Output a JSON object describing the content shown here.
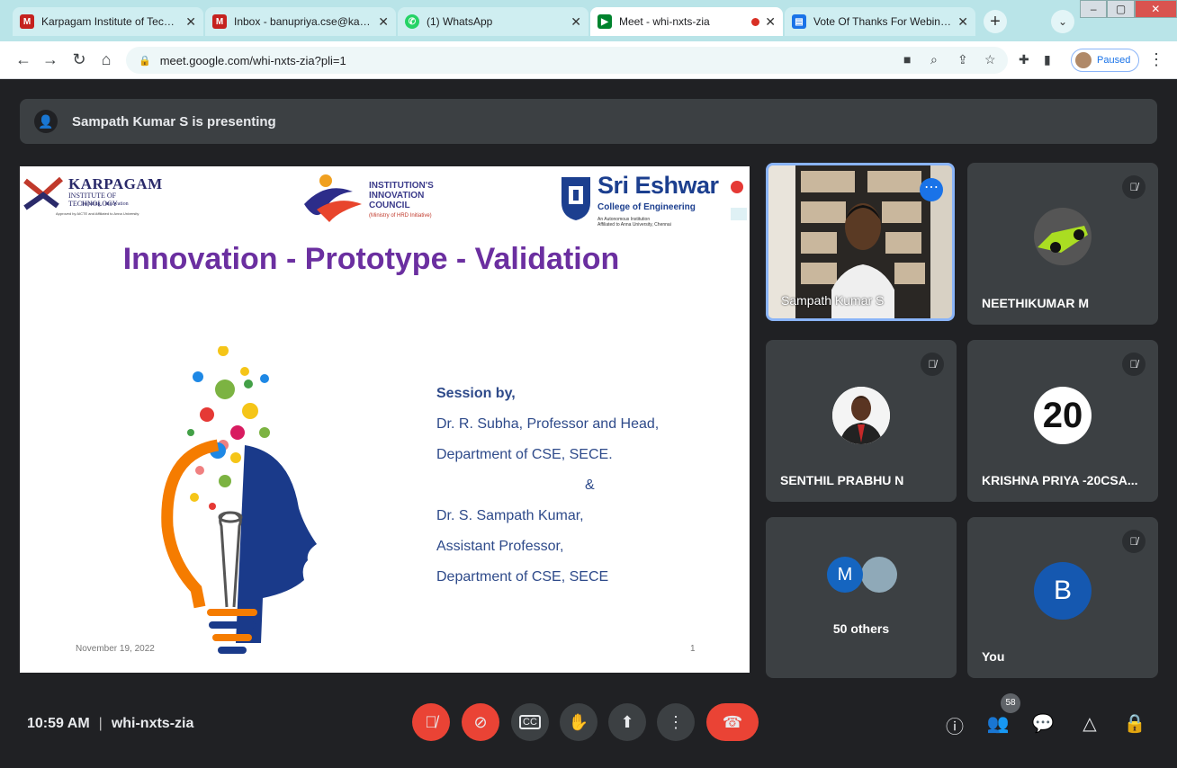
{
  "tabs": [
    {
      "title": "Karpagam Institute of Technolo",
      "icon": "gmail-icon",
      "color": "#c5221f"
    },
    {
      "title": "Inbox - banupriya.cse@karpag",
      "icon": "gmail-icon",
      "color": "#c5221f"
    },
    {
      "title": "(1) WhatsApp",
      "icon": "whatsapp-icon",
      "color": "#25d366"
    },
    {
      "title": "Meet - whi-nxts-zia",
      "icon": "meet-icon",
      "color": "#00832d"
    },
    {
      "title": "Vote Of Thanks For Webinar, I",
      "icon": "docs-icon",
      "color": "#1a73e8"
    }
  ],
  "address": {
    "url": "meet.google.com/whi-nxts-zia?pli=1",
    "profile_label": "Paused"
  },
  "presenting_text": "Sampath Kumar S is presenting",
  "slide": {
    "karpagam_name": "KARPAGAM",
    "karpagam_sub": "INSTITUTE OF TECHNOLOGY",
    "karpagam_tag": "Inspiring · Innovation",
    "karpagam_aff": "Approved by AICTE and Affiliated to Anna University",
    "iic_lines": [
      "INSTITUTION'S",
      "INNOVATION",
      "COUNCIL"
    ],
    "iic_sub": "(Ministry of HRD Initiative)",
    "sece_name": "Sri Eshwar",
    "sece_sub": "College of Engineering",
    "sece_sub2": "An Autonomous Institution",
    "sece_sub3": "Affiliated to Anna University, Chennai",
    "title": "Innovation - Prototype - Validation",
    "session_heading": "Session by,",
    "session_lines": [
      "Dr. R. Subha, Professor and Head,",
      "Department of CSE, SECE.",
      "&",
      "Dr. S. Sampath Kumar,",
      "Assistant Professor,",
      "Department of CSE, SECE"
    ],
    "date": "November 19, 2022",
    "page": "1"
  },
  "participants": [
    {
      "name": "Sampath Kumar S",
      "type": "video"
    },
    {
      "name": "NEETHIKUMAR M",
      "type": "avatar",
      "muted": true
    },
    {
      "name": "SENTHIL PRABHU N",
      "type": "avatar",
      "muted": true
    },
    {
      "name": "KRISHNA PRIYA -20CSA...",
      "type": "avatar",
      "avatar_text": "20",
      "muted": true
    },
    {
      "name": "50 others",
      "type": "group",
      "avatar_letter": "M"
    },
    {
      "name": "You",
      "type": "letter",
      "avatar_letter": "B",
      "muted": true
    }
  ],
  "bottom": {
    "time": "10:59 AM",
    "separator": "|",
    "meeting_code": "whi-nxts-zia",
    "people_count": "58"
  },
  "colors": {
    "accent": "#8ab4f8",
    "danger": "#ea4335",
    "title": "#6b2fa0",
    "session": "#2e4a8a"
  }
}
